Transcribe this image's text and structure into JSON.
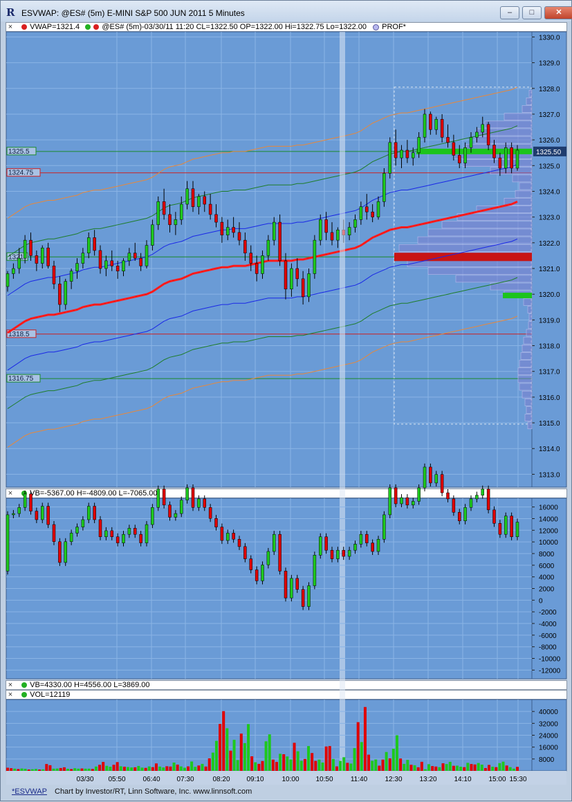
{
  "window": {
    "title": "ESVWAP: @ES# (5m) E-MINI S&P 500 JUN 2011 5 Minutes",
    "app_icon_glyph": "R",
    "buttons": {
      "minimize": "–",
      "maximize": "□",
      "close": "✕"
    }
  },
  "header_price": {
    "close_glyph": "×",
    "vwap_label": "VWAP=1321.4",
    "quote_label": "@ES# (5m)-03/30/11 11:20 CL=1322.50 OP=1322.00 Hi=1322.75 Lo=1322.00",
    "prof_label": "PROF*"
  },
  "header_vb1": {
    "close_glyph": "×",
    "label": "VB=-5367.00 H=-4809.00 L=-7065.00"
  },
  "header_vb2": {
    "close_glyph": "×",
    "label": "VB=4330.00 H=4556.00 L=3869.00"
  },
  "header_vol": {
    "close_glyph": "×",
    "label": "VOL=12119"
  },
  "footer": {
    "link": "*ESVWAP",
    "credit": "Chart by Investor/RT, Linn Software, Inc. www.linnsoft.com"
  },
  "colors": {
    "panel_bg": "#6a9bd6",
    "grid": "#8ab4e5",
    "axis_bg": "#6a9bd6",
    "up": "#1ec81e",
    "down": "#e00000",
    "vwap": "#ff1a1a",
    "band1": "#1a28e6",
    "band2": "#1e7d2a",
    "band3": "#e8883a",
    "profile": "#7b7fd0",
    "level": "#cc2020",
    "level_green": "#1a8a2a"
  },
  "chart_data": [
    {
      "id": "price",
      "type": "candlestick",
      "ylim": [
        1312.5,
        1330.2
      ],
      "yticks": [
        "1313.0",
        "1314.0",
        "1315.0",
        "1316.0",
        "1317.0",
        "1318.0",
        "1319.0",
        "1320.0",
        "1321.0",
        "1322.0",
        "1323.0",
        "1324.0",
        "1325.0",
        "1326.0",
        "1327.0",
        "1328.0",
        "1329.0",
        "1330.0"
      ],
      "last_price_label": "1325.50",
      "level_lines": [
        {
          "label": "1325.5",
          "value": 1325.55,
          "color": "green"
        },
        {
          "label": "1324.75",
          "value": 1324.72,
          "color": "red"
        },
        {
          "label": "1321",
          "value": 1321.45,
          "color": "green"
        },
        {
          "label": "1318.5",
          "value": 1318.45,
          "color": "red"
        },
        {
          "label": "1316.75",
          "value": 1316.72,
          "color": "green"
        }
      ],
      "candles": [
        [
          1320.3,
          1320.9,
          1320.1,
          1320.8
        ],
        [
          1320.8,
          1321.2,
          1320.6,
          1321.0
        ],
        [
          1321.0,
          1321.8,
          1320.8,
          1321.4
        ],
        [
          1321.4,
          1322.3,
          1321.2,
          1322.1
        ],
        [
          1322.1,
          1322.4,
          1321.3,
          1321.5
        ],
        [
          1321.5,
          1321.7,
          1320.9,
          1321.2
        ],
        [
          1321.2,
          1321.9,
          1321.0,
          1321.8
        ],
        [
          1321.8,
          1322.0,
          1321.0,
          1321.1
        ],
        [
          1321.1,
          1321.3,
          1320.2,
          1320.4
        ],
        [
          1320.4,
          1320.7,
          1319.3,
          1319.6
        ],
        [
          1319.6,
          1320.6,
          1319.4,
          1320.5
        ],
        [
          1320.5,
          1321.0,
          1320.2,
          1320.9
        ],
        [
          1320.9,
          1321.4,
          1320.6,
          1321.2
        ],
        [
          1321.2,
          1321.8,
          1321.0,
          1321.6
        ],
        [
          1321.6,
          1322.4,
          1321.4,
          1322.2
        ],
        [
          1322.2,
          1322.5,
          1321.5,
          1321.7
        ],
        [
          1321.7,
          1321.9,
          1320.8,
          1321.0
        ],
        [
          1321.0,
          1321.5,
          1320.7,
          1321.3
        ],
        [
          1321.3,
          1321.7,
          1320.9,
          1321.1
        ],
        [
          1321.1,
          1321.3,
          1320.6,
          1320.9
        ],
        [
          1320.9,
          1321.4,
          1320.7,
          1321.3
        ],
        [
          1321.3,
          1321.8,
          1321.1,
          1321.6
        ],
        [
          1321.6,
          1322.0,
          1321.3,
          1321.4
        ],
        [
          1321.4,
          1321.6,
          1320.9,
          1321.1
        ],
        [
          1321.1,
          1322.1,
          1321.0,
          1321.9
        ],
        [
          1321.9,
          1322.9,
          1321.7,
          1322.7
        ],
        [
          1322.7,
          1323.8,
          1322.5,
          1323.6
        ],
        [
          1323.6,
          1324.1,
          1322.9,
          1323.1
        ],
        [
          1323.1,
          1323.5,
          1322.4,
          1322.7
        ],
        [
          1322.7,
          1323.2,
          1322.3,
          1322.9
        ],
        [
          1322.9,
          1323.8,
          1322.7,
          1323.5
        ],
        [
          1323.5,
          1324.4,
          1323.3,
          1324.1
        ],
        [
          1324.1,
          1324.4,
          1323.2,
          1323.4
        ],
        [
          1323.4,
          1323.9,
          1323.1,
          1323.8
        ],
        [
          1323.8,
          1324.0,
          1323.2,
          1323.5
        ],
        [
          1323.5,
          1323.9,
          1322.9,
          1323.1
        ],
        [
          1323.1,
          1323.5,
          1322.6,
          1322.8
        ],
        [
          1322.8,
          1323.0,
          1322.0,
          1322.3
        ],
        [
          1322.3,
          1322.9,
          1322.1,
          1322.6
        ],
        [
          1322.6,
          1323.0,
          1322.2,
          1322.4
        ],
        [
          1322.4,
          1322.8,
          1321.9,
          1322.1
        ],
        [
          1322.1,
          1322.4,
          1321.3,
          1321.6
        ],
        [
          1321.6,
          1321.9,
          1320.9,
          1321.2
        ],
        [
          1321.2,
          1321.5,
          1320.5,
          1320.8
        ],
        [
          1320.8,
          1321.7,
          1320.6,
          1321.5
        ],
        [
          1321.5,
          1322.3,
          1321.3,
          1322.1
        ],
        [
          1322.1,
          1323.0,
          1321.9,
          1322.8
        ],
        [
          1322.8,
          1323.1,
          1321.1,
          1321.3
        ],
        [
          1321.3,
          1321.6,
          1319.8,
          1320.2
        ],
        [
          1320.2,
          1321.2,
          1319.9,
          1321.0
        ],
        [
          1321.0,
          1321.4,
          1320.3,
          1320.6
        ],
        [
          1320.6,
          1320.9,
          1319.6,
          1319.9
        ],
        [
          1319.9,
          1321.0,
          1319.7,
          1320.8
        ],
        [
          1320.8,
          1322.3,
          1320.6,
          1322.1
        ],
        [
          1322.1,
          1323.1,
          1321.9,
          1322.9
        ],
        [
          1322.9,
          1323.2,
          1322.1,
          1322.4
        ],
        [
          1322.4,
          1322.8,
          1321.9,
          1322.1
        ],
        [
          1322.1,
          1322.6,
          1321.8,
          1322.5
        ],
        [
          1322.5,
          1322.9,
          1322.0,
          1322.3
        ],
        [
          1322.3,
          1322.8,
          1322.1,
          1322.6
        ],
        [
          1322.6,
          1323.1,
          1322.4,
          1322.9
        ],
        [
          1322.9,
          1323.6,
          1322.7,
          1323.4
        ],
        [
          1323.4,
          1323.9,
          1322.9,
          1323.2
        ],
        [
          1323.2,
          1323.5,
          1322.8,
          1323.0
        ],
        [
          1323.0,
          1323.8,
          1322.9,
          1323.6
        ],
        [
          1323.6,
          1324.9,
          1323.4,
          1324.7
        ],
        [
          1324.7,
          1326.1,
          1324.5,
          1325.9
        ],
        [
          1325.9,
          1326.4,
          1325.0,
          1325.3
        ],
        [
          1325.3,
          1325.8,
          1324.9,
          1325.6
        ],
        [
          1325.6,
          1326.0,
          1325.1,
          1325.3
        ],
        [
          1325.3,
          1325.7,
          1325.0,
          1325.5
        ],
        [
          1325.5,
          1326.3,
          1325.3,
          1326.1
        ],
        [
          1326.1,
          1327.2,
          1325.9,
          1327.0
        ],
        [
          1327.0,
          1327.1,
          1326.2,
          1326.4
        ],
        [
          1326.4,
          1326.9,
          1326.2,
          1326.8
        ],
        [
          1326.8,
          1327.0,
          1325.9,
          1326.1
        ],
        [
          1326.1,
          1326.6,
          1325.7,
          1325.9
        ],
        [
          1325.9,
          1326.2,
          1325.2,
          1325.4
        ],
        [
          1325.4,
          1325.8,
          1324.9,
          1325.1
        ],
        [
          1325.1,
          1325.9,
          1324.9,
          1325.7
        ],
        [
          1325.7,
          1326.3,
          1325.5,
          1326.1
        ],
        [
          1326.1,
          1326.5,
          1325.9,
          1326.3
        ],
        [
          1326.3,
          1326.9,
          1326.1,
          1326.6
        ],
        [
          1326.6,
          1326.7,
          1325.6,
          1325.8
        ],
        [
          1325.8,
          1326.0,
          1325.1,
          1325.3
        ],
        [
          1325.3,
          1325.5,
          1324.6,
          1324.9
        ],
        [
          1324.9,
          1325.9,
          1324.7,
          1325.7
        ],
        [
          1325.7,
          1325.9,
          1324.7,
          1324.9
        ],
        [
          1324.9,
          1325.8,
          1324.8,
          1325.6
        ]
      ],
      "vwap": [
        1318.5,
        1318.65,
        1318.8,
        1318.95,
        1319.05,
        1319.1,
        1319.15,
        1319.2,
        1319.2,
        1319.25,
        1319.3,
        1319.35,
        1319.4,
        1319.5,
        1319.55,
        1319.6,
        1319.6,
        1319.65,
        1319.7,
        1319.75,
        1319.8,
        1319.85,
        1319.9,
        1319.95,
        1320.0,
        1320.1,
        1320.25,
        1320.4,
        1320.5,
        1320.55,
        1320.6,
        1320.7,
        1320.8,
        1320.85,
        1320.9,
        1320.95,
        1321.0,
        1321.05,
        1321.05,
        1321.1,
        1321.1,
        1321.1,
        1321.15,
        1321.2,
        1321.25,
        1321.3,
        1321.3,
        1321.3,
        1321.3,
        1321.3,
        1321.35,
        1321.35,
        1321.4,
        1321.45,
        1321.5,
        1321.55,
        1321.6,
        1321.65,
        1321.7,
        1321.75,
        1321.8,
        1321.9,
        1322.05,
        1322.2,
        1322.3,
        1322.4,
        1322.5,
        1322.55,
        1322.6,
        1322.6,
        1322.65,
        1322.7,
        1322.75,
        1322.8,
        1322.85,
        1322.9,
        1322.95,
        1323.0,
        1323.05,
        1323.1,
        1323.15,
        1323.2,
        1323.25,
        1323.3,
        1323.35,
        1323.4,
        1323.45,
        1323.5,
        1323.6
      ],
      "band_offsets": {
        "band1": 1.45,
        "band2": 2.95,
        "band3": 4.45
      },
      "profile": [
        [
          1327.8,
          4
        ],
        [
          1327.5,
          8
        ],
        [
          1327.2,
          14
        ],
        [
          1326.9,
          40
        ],
        [
          1326.6,
          68
        ],
        [
          1326.3,
          80
        ],
        [
          1326.0,
          82
        ],
        [
          1325.7,
          95
        ],
        [
          1325.4,
          112
        ],
        [
          1325.1,
          100
        ],
        [
          1324.8,
          60
        ],
        [
          1324.5,
          28
        ],
        [
          1324.2,
          18
        ],
        [
          1323.9,
          24
        ],
        [
          1323.6,
          40
        ],
        [
          1323.3,
          80
        ],
        [
          1323.0,
          108
        ],
        [
          1322.7,
          130
        ],
        [
          1322.4,
          150
        ],
        [
          1322.1,
          165
        ],
        [
          1321.8,
          192
        ],
        [
          1321.5,
          198
        ],
        [
          1321.2,
          180
        ],
        [
          1320.9,
          150
        ],
        [
          1320.6,
          110
        ],
        [
          1320.3,
          60
        ],
        [
          1320.0,
          40
        ],
        [
          1319.7,
          12
        ],
        [
          1319.4,
          6
        ],
        [
          1319.1,
          4
        ],
        [
          1318.8,
          5
        ],
        [
          1318.5,
          8
        ],
        [
          1318.2,
          12
        ],
        [
          1317.9,
          14
        ],
        [
          1317.6,
          16
        ],
        [
          1317.3,
          18
        ],
        [
          1317.0,
          20
        ],
        [
          1316.7,
          20
        ],
        [
          1316.4,
          18
        ],
        [
          1316.1,
          14
        ],
        [
          1315.8,
          10
        ],
        [
          1315.5,
          8
        ],
        [
          1315.2,
          10
        ],
        [
          1314.9,
          6
        ]
      ],
      "x_start_label": "03/30",
      "xticks": [
        "03/30",
        "05:50",
        "06:40",
        "07:30",
        "08:20",
        "09:10",
        "10:00",
        "10:50",
        "11:40",
        "12:30",
        "13:20",
        "14:10",
        "15:00",
        "15:30"
      ]
    },
    {
      "id": "volume_balance",
      "type": "candlestick",
      "ylim": [
        -13500,
        17500
      ],
      "yticks": [
        "-12000",
        "-10000",
        "-8000",
        "-6000",
        "-4000",
        "-2000",
        "0",
        "2000",
        "4000",
        "6000",
        "8000",
        "10000",
        "12000",
        "14000",
        "16000"
      ]
    },
    {
      "id": "volume",
      "type": "bar",
      "ylim": [
        0,
        48000
      ],
      "yticks": [
        "8000",
        "16000",
        "24000",
        "32000",
        "40000"
      ],
      "values": [
        2100,
        1800,
        1500,
        1200,
        1600,
        1400,
        900,
        1100,
        1300,
        900,
        1000,
        4600,
        3800,
        1500,
        1600,
        1900,
        2400,
        1400,
        1200,
        1800,
        1500,
        1600,
        1500,
        1500,
        1300,
        2900,
        4100,
        6000,
        3400,
        2800,
        4100,
        5900,
        3100,
        2800,
        2600,
        2300,
        2400,
        3300,
        2200,
        2000,
        3000,
        2500,
        5000,
        2900,
        2300,
        3100,
        2900,
        5600,
        4200,
        3000,
        2100,
        3000,
        6300,
        2700,
        3600,
        4700,
        2900,
        8400,
        12300,
        20200,
        31600,
        40200,
        28700,
        13600,
        20900,
        7300,
        25100,
        18700,
        31500,
        9800,
        5800,
        4700,
        6600,
        19900,
        24600,
        7600,
        6000,
        11500,
        11200,
        9700,
        7700,
        18900,
        13200,
        6800,
        8000,
        16700,
        12000,
        6700,
        7600,
        5600,
        16400,
        16700,
        8000,
        3000,
        6700,
        9200,
        5400,
        4900,
        15300,
        32800,
        19400,
        43000,
        10900,
        6800,
        7700,
        3500,
        7600,
        12700,
        8400,
        14900,
        24000,
        8300,
        4700,
        7400,
        4100,
        3800,
        2400,
        6100,
        1100,
        4500,
        3200,
        2900,
        2500,
        5100,
        4600,
        6100,
        3400,
        3500,
        2800,
        2500,
        5400,
        4600,
        4300,
        5300,
        4200,
        1900,
        4000,
        2800,
        2500,
        5200,
        6200,
        3600,
        2500,
        1500,
        2700
      ]
    }
  ]
}
